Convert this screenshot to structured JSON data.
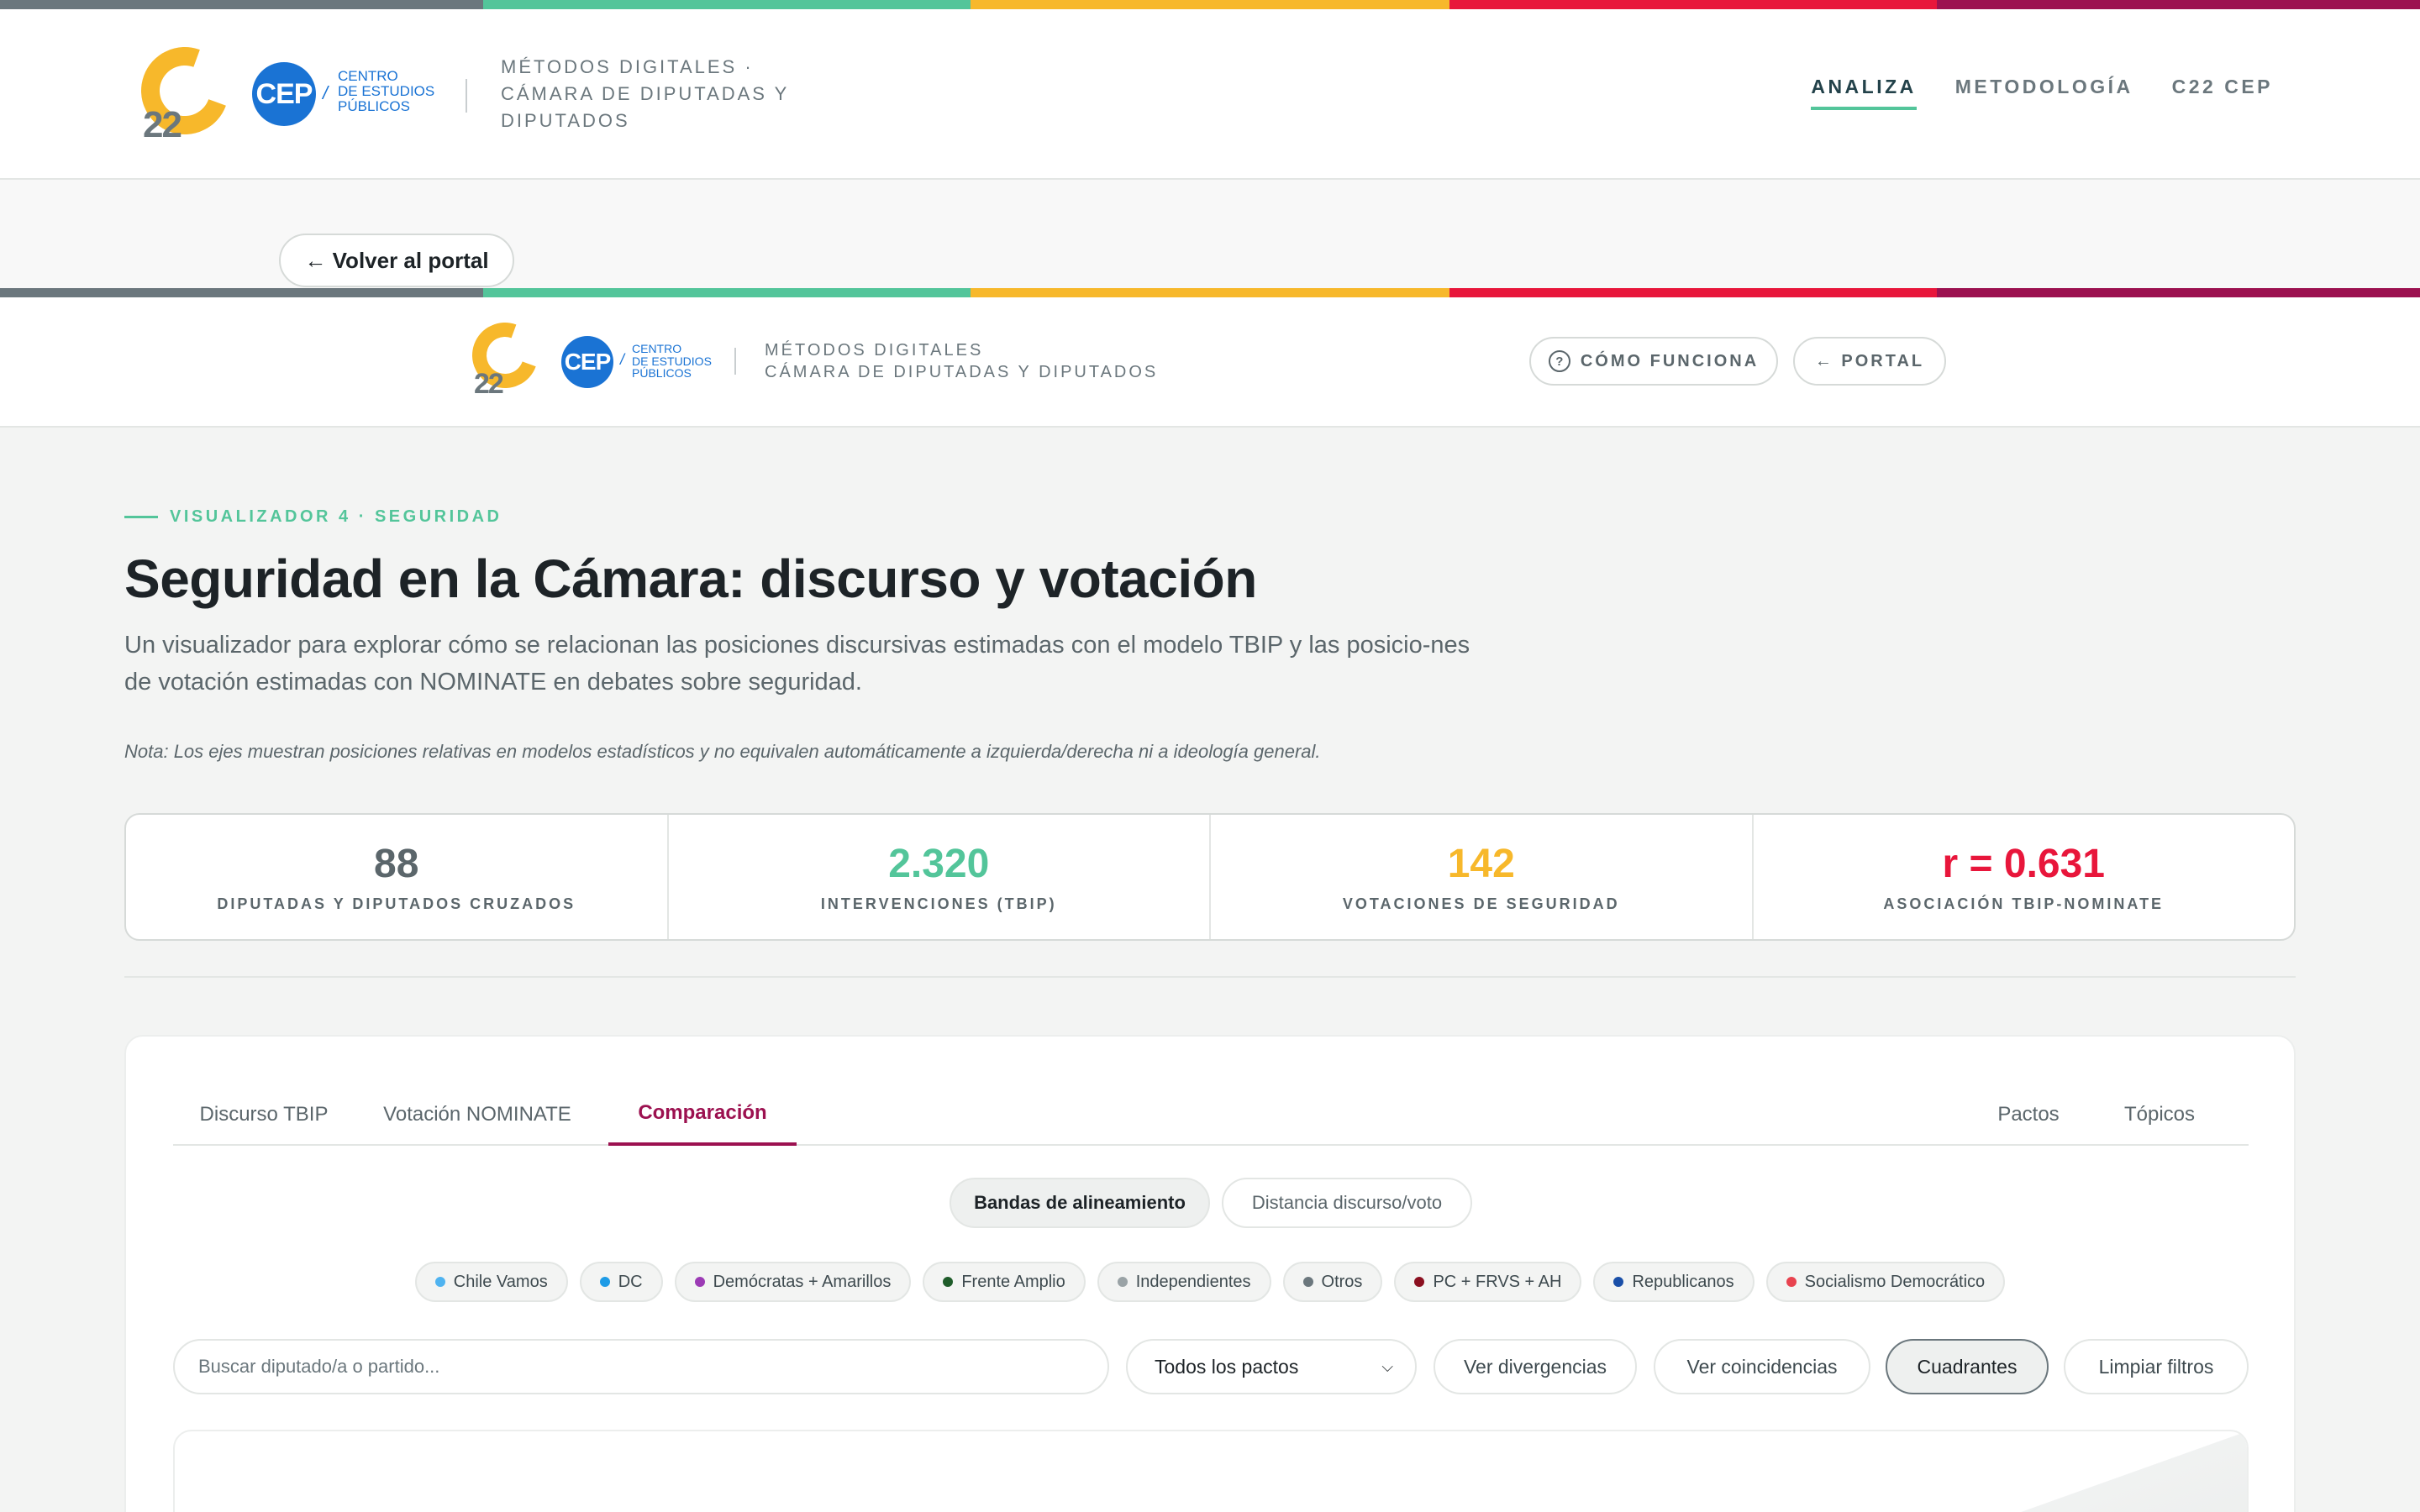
{
  "portal": {
    "logo_number": "22",
    "cep_badge": "CEP",
    "cep_lines": [
      "CENTRO",
      "DE ESTUDIOS",
      "PÚBLICOS"
    ],
    "site_label_lines": [
      "MÉTODOS DIGITALES ·",
      "CÁMARA DE DIPUTADAS Y",
      "DIPUTADOS"
    ],
    "nav": [
      {
        "label": "ANALIZA",
        "active": true
      },
      {
        "label": "METODOLOGÍA",
        "active": false
      },
      {
        "label": "C22 CEP",
        "active": false
      }
    ],
    "back_button": "← Volver al portal"
  },
  "app": {
    "site_label_lines": [
      "MÉTODOS DIGITALES",
      "CÁMARA DE DIPUTADAS Y DIPUTADOS"
    ],
    "how_button": "CÓMO FUNCIONA",
    "portal_button": "← PORTAL"
  },
  "hero": {
    "eyebrow": "VISUALIZADOR 4 · SEGURIDAD",
    "title": "Seguridad en la Cámara: discurso y votación",
    "description": "Un visualizador para explorar cómo se relacionan las posiciones discursivas estimadas con el modelo TBIP y las posicio-nes de votación estimadas con NOMINATE en debates sobre seguridad.",
    "note": "Nota: Los ejes muestran posiciones relativas en modelos estadísticos y no equivalen automáticamente a izquierda/derecha ni a ideología general."
  },
  "stats": [
    {
      "value": "88",
      "label": "DIPUTADAS Y DIPUTADOS CRUZADOS",
      "color": "#5b666b"
    },
    {
      "value": "2.320",
      "label": "INTERVENCIONES (TBIP)",
      "color": "#53c59a"
    },
    {
      "value": "142",
      "label": "VOTACIONES DE SEGURIDAD",
      "color": "#f7b82b"
    },
    {
      "value": "r = 0.631",
      "label": "ASOCIACIÓN TBIP-NOMINATE",
      "color": "#e8163b"
    }
  ],
  "tabs": {
    "left": [
      "Discurso TBIP",
      "Votación NOMINATE",
      "Comparación"
    ],
    "active": "Comparación",
    "right": [
      "Pactos",
      "Tópicos"
    ]
  },
  "view_toggle": {
    "options": [
      "Bandas de alineamiento",
      "Distancia discurso/voto"
    ],
    "active": "Bandas de alineamiento"
  },
  "parties": [
    {
      "name": "Chile Vamos",
      "color": "#4fb3f0"
    },
    {
      "name": "DC",
      "color": "#1d9be6"
    },
    {
      "name": "Demócratas + Amarillos",
      "color": "#9c3bb5"
    },
    {
      "name": "Frente Amplio",
      "color": "#1f5c2a"
    },
    {
      "name": "Independientes",
      "color": "#9aa3a6"
    },
    {
      "name": "Otros",
      "color": "#6b777d"
    },
    {
      "name": "PC + FRVS + AH",
      "color": "#8b1020"
    },
    {
      "name": "Republicanos",
      "color": "#1a4fa8"
    },
    {
      "name": "Socialismo Democrático",
      "color": "#e8434f"
    }
  ],
  "filters": {
    "search_placeholder": "Buscar diputado/a o partido...",
    "pact_select": "Todos los pactos",
    "buttons": [
      "Ver divergencias",
      "Ver coincidencias",
      "Cuadrantes",
      "Limpiar filtros"
    ],
    "active_button": "Cuadrantes"
  }
}
